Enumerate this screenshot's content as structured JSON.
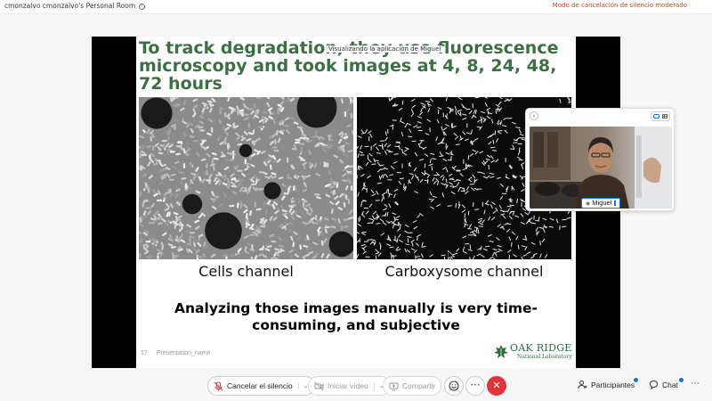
{
  "header": {
    "room_title": "cmonzalvo cmonzalvo's Personal Room",
    "info_icon_label": "i",
    "noise_mode": "Modo de cancelación de silencio moderado"
  },
  "share": {
    "viewing_banner": "Visualizando la aplicación de Miguel",
    "slide": {
      "title": "To track degradation, they use fluorescence microscopy and took images at 4, 8, 24, 48, 72 hours",
      "left_caption": "Cells channel",
      "right_caption": "Carboxysome channel",
      "statement": "Analyzing those images manually is very time-consuming, and subjective",
      "slide_number": "17",
      "footer_text": "Presentation_name",
      "logo": {
        "name": "OAK RIDGE",
        "subtitle": "National Laboratory",
        "color": "#2f6a38"
      },
      "title_color": "#3b7044"
    }
  },
  "video_panel": {
    "participant_name": "Miguel",
    "collapse_icon": "chevron-down-icon",
    "layout_options": [
      "single-view-icon",
      "grid-view-icon"
    ]
  },
  "controls": {
    "mute_label": "Cancelar el silencio",
    "video_label": "Iniciar vídeo",
    "share_label": "Compartir",
    "reactions_icon": "smiley-icon",
    "more_icon": "ellipsis-icon",
    "leave_icon": "close-icon",
    "leave_color": "#e0353b"
  },
  "side_controls": {
    "participants_label": "Participantes",
    "chat_label": "Chat",
    "notification_color": "#1b73d1",
    "more_icon": "ellipsis-icon"
  }
}
